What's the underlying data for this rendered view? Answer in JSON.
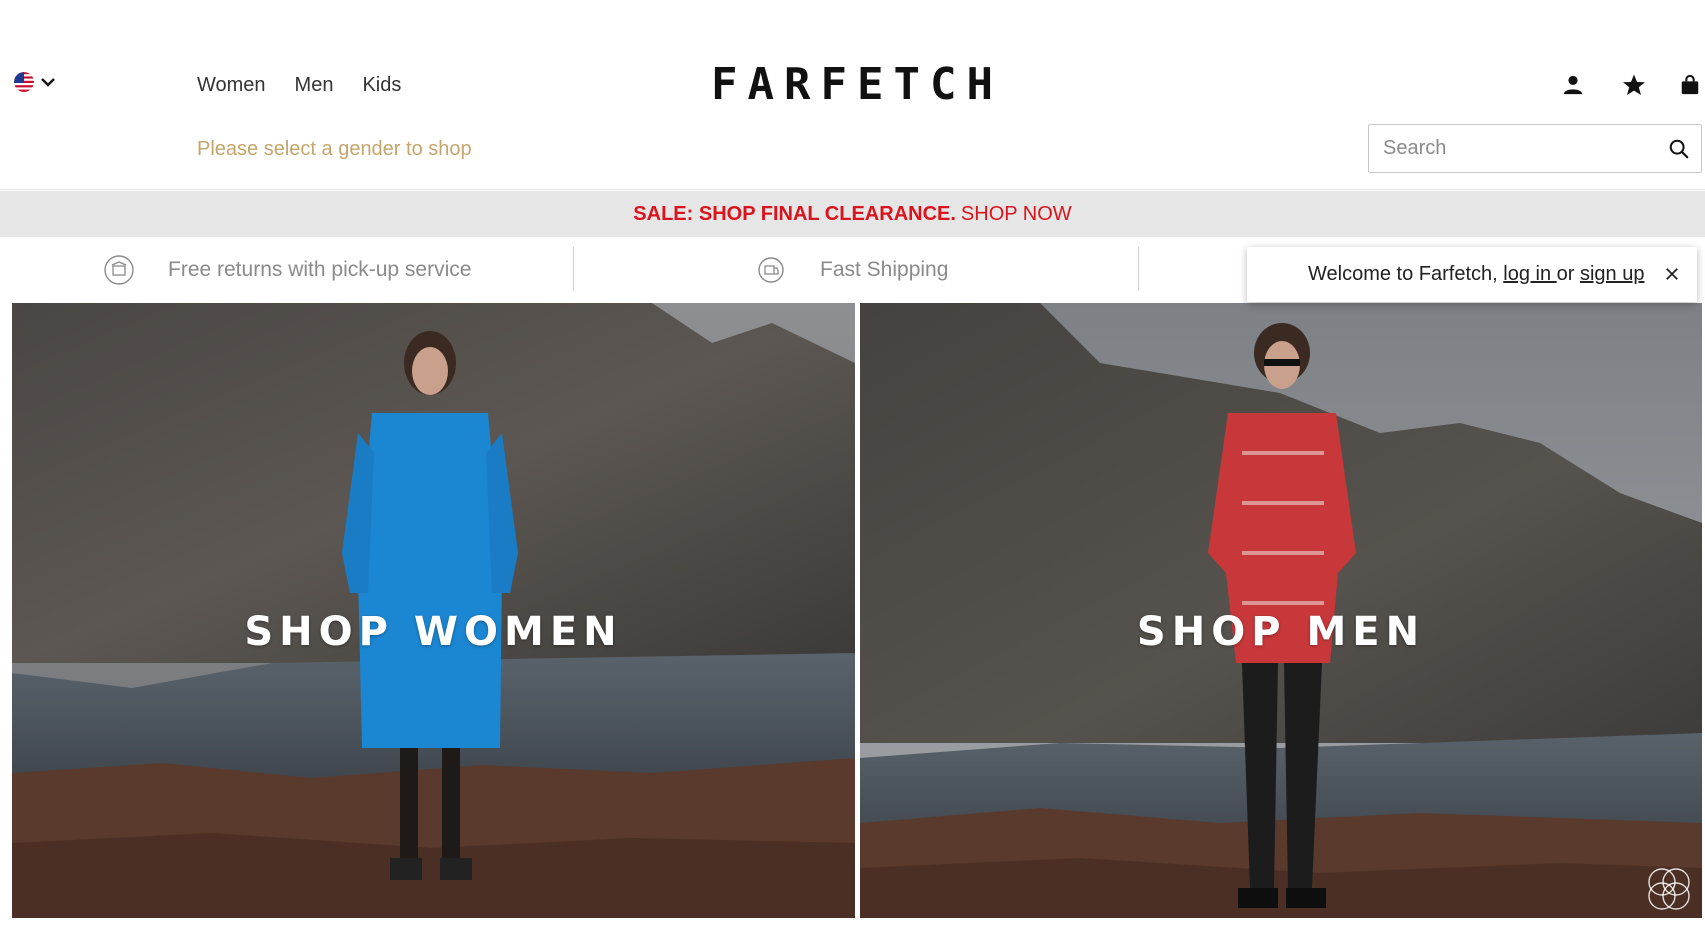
{
  "header": {
    "locale": {
      "flag_icon": "us-flag-icon",
      "chevron_icon": "chevron-down-icon"
    },
    "nav": [
      {
        "label": "Women"
      },
      {
        "label": "Men"
      },
      {
        "label": "Kids"
      }
    ],
    "gender_hint": "Please select a gender to shop",
    "logo": "FARFETCH",
    "icons": [
      "account-icon",
      "wishlist-star-icon",
      "shopping-bag-icon"
    ],
    "search": {
      "placeholder": "Search",
      "value": "",
      "icon": "search-icon"
    }
  },
  "promo": {
    "sale_text": "SALE: SHOP FINAL CLEARANCE.",
    "link_text": "SHOP NOW",
    "color": "#d9141c"
  },
  "usp": [
    {
      "icon": "returns-icon",
      "text": "Free returns with pick-up service"
    },
    {
      "icon": "shipping-icon",
      "text": "Fast Shipping"
    }
  ],
  "welcome": {
    "prefix": "Welcome to Farfetch, ",
    "login": "log in ",
    "middle": "or ",
    "signup": "sign up",
    "close_icon": "close-icon"
  },
  "hero": {
    "women": {
      "label": "SHOP WOMEN"
    },
    "men": {
      "label": "SHOP MEN"
    }
  },
  "colors": {
    "accent_hint": "#c5a46d",
    "promo_bg": "#e6e6e6",
    "text": "#222222"
  }
}
